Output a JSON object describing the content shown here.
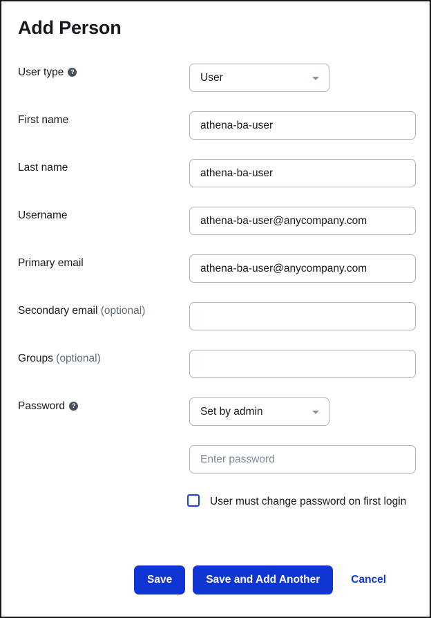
{
  "page": {
    "title": "Add Person"
  },
  "fields": [
    {
      "id": "user-type",
      "label": "User type",
      "optional_suffix": "",
      "has_help_icon": true,
      "help_icon": "help-icon",
      "control": "select",
      "value": "User",
      "placeholder": ""
    },
    {
      "id": "first-name",
      "label": "First name",
      "optional_suffix": "",
      "has_help_icon": false,
      "control": "text",
      "value": "athena-ba-user",
      "placeholder": ""
    },
    {
      "id": "last-name",
      "label": "Last name",
      "optional_suffix": "",
      "has_help_icon": false,
      "control": "text",
      "value": "athena-ba-user",
      "placeholder": ""
    },
    {
      "id": "username",
      "label": "Username",
      "optional_suffix": "",
      "has_help_icon": false,
      "control": "text",
      "value": "athena-ba-user@anycompany.com",
      "placeholder": ""
    },
    {
      "id": "primary-email",
      "label": "Primary email",
      "optional_suffix": "",
      "has_help_icon": false,
      "control": "text",
      "value": "athena-ba-user@anycompany.com",
      "placeholder": ""
    },
    {
      "id": "secondary-email",
      "label": "Secondary email",
      "optional_suffix": "(optional)",
      "has_help_icon": false,
      "control": "text",
      "value": "",
      "placeholder": ""
    },
    {
      "id": "groups",
      "label": "Groups",
      "optional_suffix": "(optional)",
      "has_help_icon": false,
      "control": "text",
      "value": "",
      "placeholder": ""
    },
    {
      "id": "password",
      "label": "Password",
      "optional_suffix": "",
      "has_help_icon": true,
      "help_icon": "help-icon",
      "control": "select",
      "value": "Set by admin",
      "placeholder": ""
    }
  ],
  "password_input": {
    "value": "",
    "placeholder": "Enter password"
  },
  "checkbox": {
    "label": "User must change password on first login",
    "checked": false
  },
  "actions": {
    "save_label": "Save",
    "save_and_add_another_label": "Save and Add Another",
    "cancel_label": "Cancel"
  },
  "colors": {
    "accent": "#0f35d4",
    "text": "#16191f",
    "muted": "#5f6b7a",
    "border": "#aab2bd",
    "placeholder": "#7d8998",
    "help_icon_bg": "#4a5260"
  }
}
